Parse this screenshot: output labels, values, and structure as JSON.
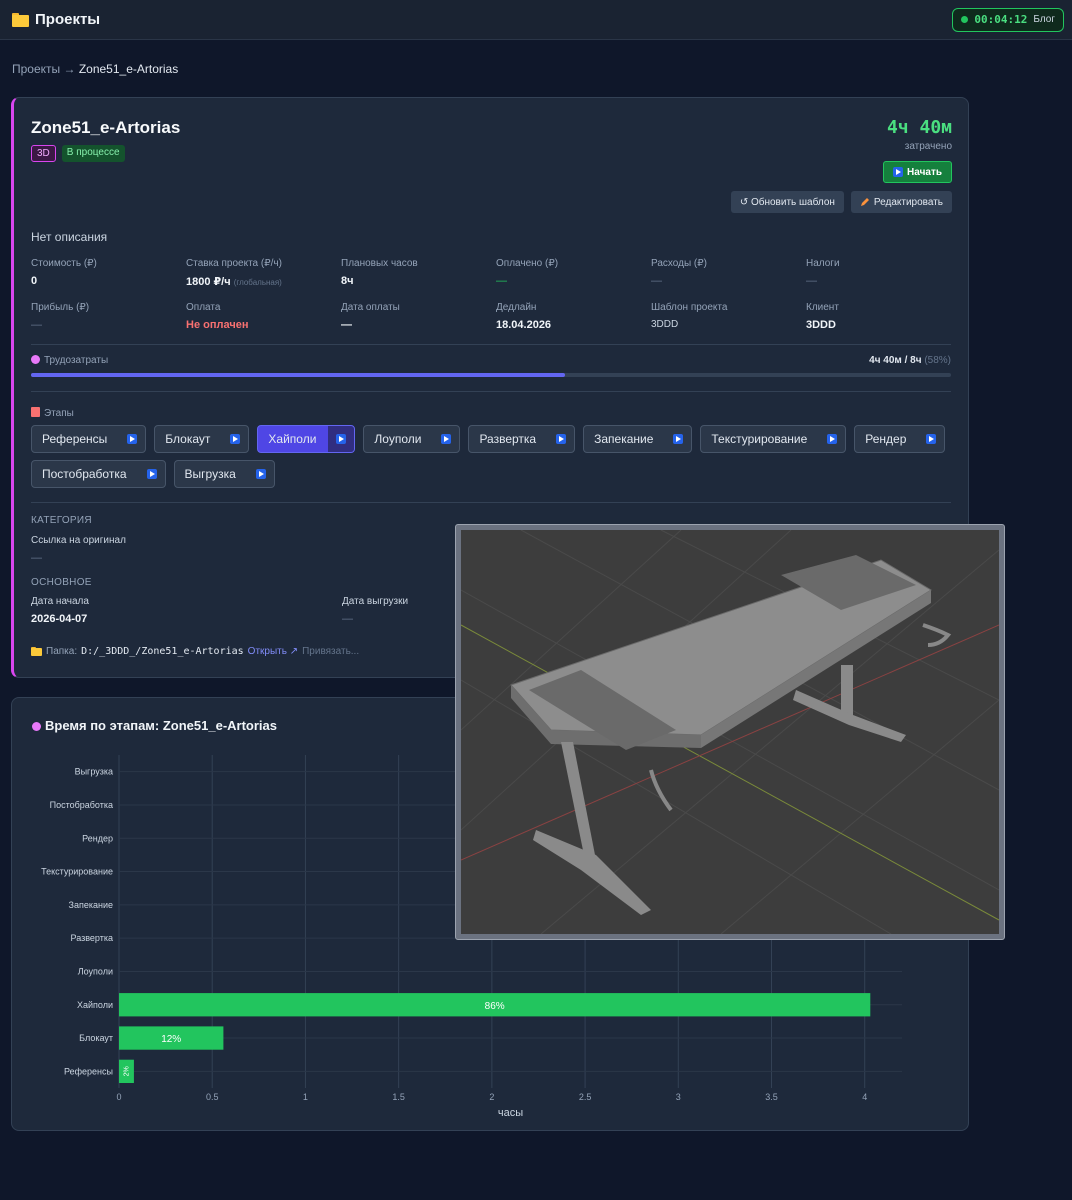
{
  "topbar": {
    "title": "Проекты",
    "timer": "00:04:12",
    "timer_label": "Блог"
  },
  "breadcrumb": {
    "root": "Проекты",
    "sep": " → ",
    "current": "Zone51_e-Artorias"
  },
  "project": {
    "title": "Zone51_e-Artorias",
    "tag_type": "3D",
    "tag_status": "В процессе",
    "spent_value": "4ч 40м",
    "spent_label": "затрачено",
    "start_button": "Начать",
    "update_template_button": "↺ Обновить шаблон",
    "edit_button": "Редактировать",
    "description": "Нет описания"
  },
  "stats": {
    "cost_label": "Стоимость (₽)",
    "cost": "0",
    "rate_label": "Ставка проекта (₽/ч)",
    "rate": "1800 ₽/ч",
    "rate_note": "(глобальная)",
    "planned_label": "Плановых часов",
    "planned": "8ч",
    "paid_label": "Оплачено (₽)",
    "paid": "—",
    "expenses_label": "Расходы (₽)",
    "expenses": "—",
    "taxes_label": "Налоги",
    "taxes": "—",
    "profit_label": "Прибыль (₽)",
    "profit": "—",
    "payment_label": "Оплата",
    "payment": "Не оплачен",
    "payment_date_label": "Дата оплаты",
    "payment_date": "—",
    "deadline_label": "Дедлайн",
    "deadline": "18.04.2026",
    "template_label": "Шаблон проекта",
    "template": "3DDD",
    "client_label": "Клиент",
    "client": "3DDD"
  },
  "labor": {
    "label": "Трудозатраты",
    "value": "4ч 40м / 8ч",
    "percent_text": "(58%)",
    "progress": 0.58
  },
  "stages": {
    "label": "Этапы",
    "items": [
      {
        "name": "Референсы",
        "active": false
      },
      {
        "name": "Блокаут",
        "active": false
      },
      {
        "name": "Хайполи",
        "active": true
      },
      {
        "name": "Лоуполи",
        "active": false
      },
      {
        "name": "Развертка",
        "active": false
      },
      {
        "name": "Запекание",
        "active": false
      },
      {
        "name": "Текстурирование",
        "active": false
      },
      {
        "name": "Рендер",
        "active": false
      },
      {
        "name": "Постобработка",
        "active": false
      },
      {
        "name": "Выгрузка",
        "active": false
      }
    ]
  },
  "details": {
    "category_title": "КАТЕГОРИЯ",
    "original_link_label": "Ссылка на оригинал",
    "original_link": "—",
    "main_title": "ОСНОВНОЕ",
    "start_date_label": "Дата начала",
    "start_date": "2026-04-07",
    "upload_date_label": "Дата выгрузки",
    "upload_date": "—",
    "folder_label": "Папка:",
    "folder_path": "D:/_3DDD_/Zone51_e-Artorias",
    "open_link": "Открыть ↗",
    "bind_link": "Привязать..."
  },
  "chart_data": {
    "type": "bar",
    "orientation": "horizontal",
    "title": "Время по этапам: Zone51_e-Artorias",
    "xlabel": "часы",
    "ylabel": "",
    "categories": [
      "Референсы",
      "Блокаут",
      "Хайполи",
      "Лоуполи",
      "Развертка",
      "Запекание",
      "Текстурирование",
      "Рендер",
      "Постобработка",
      "Выгрузка"
    ],
    "values": [
      0.08,
      0.56,
      4.03,
      0,
      0,
      0,
      0,
      0,
      0,
      0
    ],
    "data_labels": [
      "2%",
      "12%",
      "86%",
      "",
      "",
      "",
      "",
      "",
      "",
      ""
    ],
    "xlim": [
      0,
      4.2
    ],
    "xticks": [
      "0",
      "0.5",
      "1",
      "1.5",
      "2",
      "2.5",
      "3",
      "3.5",
      "4"
    ],
    "grid": true,
    "bar_color": "#22c55e"
  },
  "colors": {
    "accent": "#d946ef",
    "success": "#22c55e",
    "primary": "#6366f1",
    "danger": "#f87171"
  }
}
